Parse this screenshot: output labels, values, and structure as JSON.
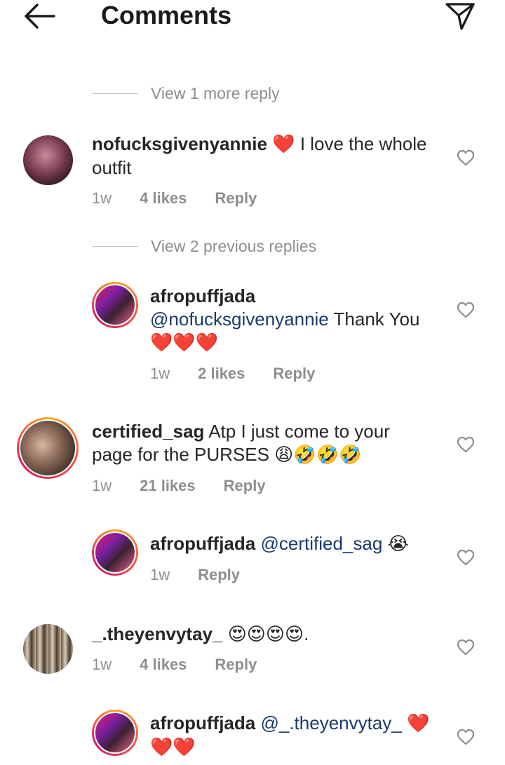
{
  "header": {
    "title": "Comments"
  },
  "view_more_top": {
    "label": "View 1 more reply"
  },
  "view_previous": {
    "label": "View 2 previous replies"
  },
  "comments": [
    {
      "username": "nofucksgivenyannie",
      "text_line1": "I love the whole",
      "text_line2": "outfit",
      "emoji": "❤️",
      "time": "1w",
      "likes": "4 likes",
      "reply": "Reply"
    },
    {
      "username": "afropuffjada",
      "mention": "@nofucksgivenyannie",
      "text": "Thank You",
      "emoji": "❤️❤️❤️",
      "time": "1w",
      "likes": "2 likes",
      "reply": "Reply"
    },
    {
      "username": "certified_sag",
      "text_line1": "Atp I just come to your",
      "text_line2": "page for the PURSES",
      "emoji": "😩🤣🤣🤣",
      "time": "1w",
      "likes": "21 likes",
      "reply": "Reply"
    },
    {
      "username": "afropuffjada",
      "mention": "@certified_sag",
      "emoji": "😭",
      "time": "1w",
      "reply": "Reply"
    },
    {
      "username": "_.theyenvytay_",
      "emoji": "😍😍😍😍",
      "trailing": ".",
      "time": "1w",
      "likes": "4 likes",
      "reply": "Reply"
    },
    {
      "username": "afropuffjada",
      "mention": "@_.theyenvytay_",
      "emoji_line1": "❤️",
      "emoji_line2": "❤️❤️"
    }
  ],
  "colors": {
    "text": "#262626",
    "muted": "#8e8e8e",
    "mention": "#1a3a6b",
    "heart": "#e0161b",
    "ring_gradient": [
      "#f9a825",
      "#ef5350",
      "#d81b60"
    ]
  }
}
